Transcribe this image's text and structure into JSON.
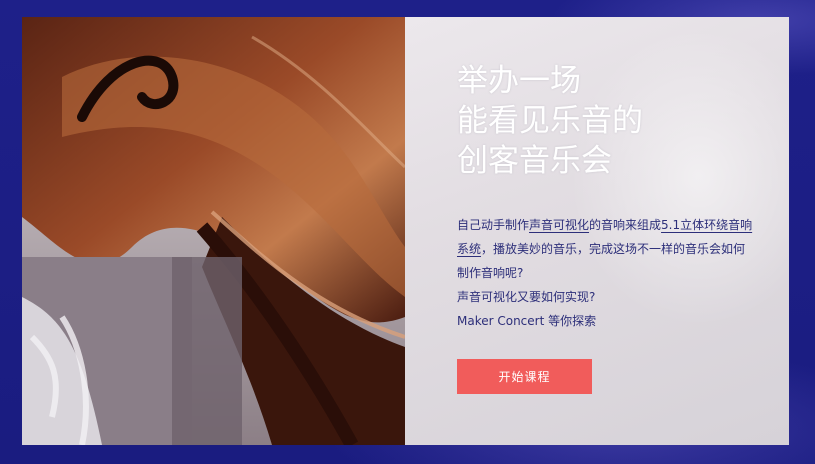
{
  "hero": {
    "headline_lines": [
      "举办一场",
      "能看见乐音的",
      "创客音乐会"
    ],
    "description": {
      "p1_before": "自己动手制作",
      "p1_link1": "声音可视化",
      "p1_mid": "的音响来组成",
      "p1_link2": "5.1立体环绕音响系统",
      "p1_after": "，播放美妙的音乐，完成这场不一样的音乐会如何制作音响呢?",
      "line2": "声音可视化又要如何实现?",
      "line3": "Maker Concert 等你探索"
    },
    "cta_label": "开始课程",
    "photo_subject": "violin"
  },
  "colors": {
    "background": "#1d1f86",
    "cta": "#f15c5b",
    "text_dark": "#2d2f7a",
    "headline": "#ffffff"
  }
}
